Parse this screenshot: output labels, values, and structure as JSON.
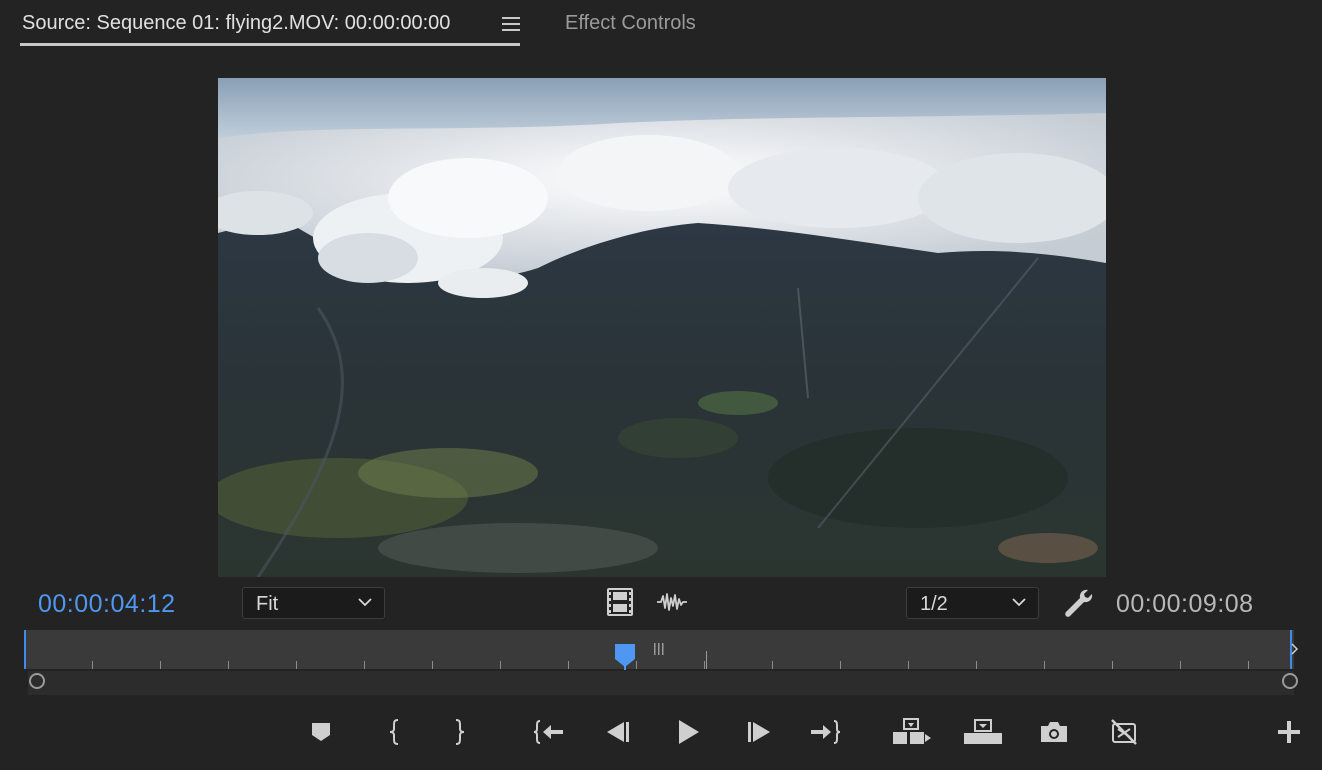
{
  "tabs": {
    "source_label": "Source: Sequence 01: flying2.MOV: 00:00:00:00",
    "effect_controls_label": "Effect Controls"
  },
  "viewer": {
    "zoom_label": "Fit",
    "resolution_label": "1/2"
  },
  "timecodes": {
    "current": "00:00:04:12",
    "duration": "00:00:09:08"
  },
  "colors": {
    "accent": "#4f97f0",
    "background": "#232323",
    "icon": "#cfcfcf"
  },
  "playhead": {
    "position_fraction": 0.473
  },
  "icons": {
    "drag_video": "film-icon",
    "drag_audio": "audio-waveform-icon",
    "settings": "wrench-icon",
    "add_marker": "marker-icon",
    "mark_in": "mark-in-icon",
    "mark_out": "mark-out-icon",
    "go_to_in": "go-to-in-icon",
    "step_back": "step-back-icon",
    "play": "play-icon",
    "step_forward": "step-forward-icon",
    "go_to_out": "go-to-out-icon",
    "insert": "insert-icon",
    "overwrite": "overwrite-icon",
    "export_frame": "camera-icon",
    "button_editor": "button-editor-icon",
    "add": "plus-icon"
  }
}
